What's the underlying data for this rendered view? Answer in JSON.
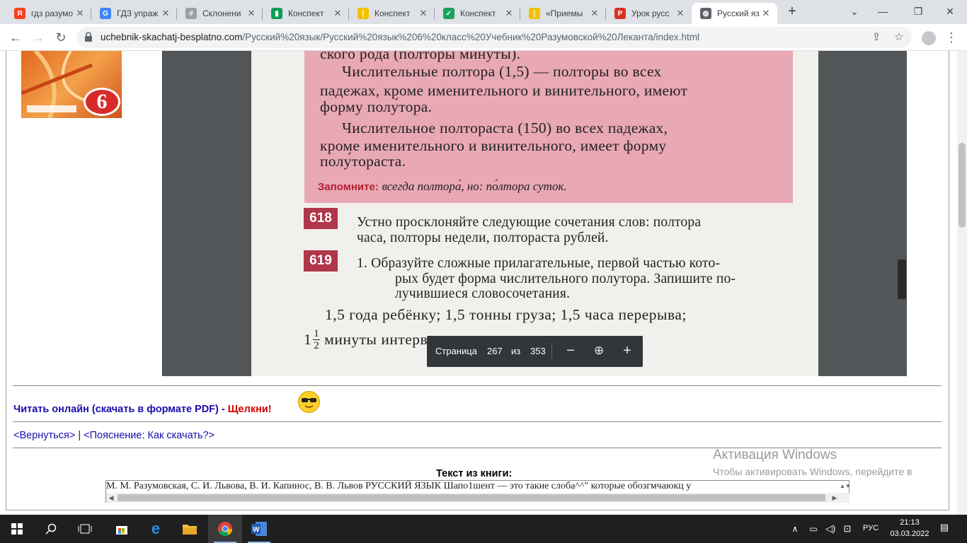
{
  "browser": {
    "tabs": [
      {
        "title": "гдз разумо",
        "favicon": "yandex-icon",
        "color": "#fc3f1d",
        "glyph": "Я"
      },
      {
        "title": "ГДЗ упраж",
        "favicon": "google-icon",
        "color": "#4285f4",
        "glyph": "G"
      },
      {
        "title": "Склонени",
        "favicon": "hash-icon",
        "color": "#9aa0a6",
        "glyph": "#"
      },
      {
        "title": "Конспект",
        "favicon": "sheets-icon",
        "color": "#0f9d58",
        "glyph": "▮"
      },
      {
        "title": "Конспект",
        "favicon": "bookmark-icon",
        "color": "#f6c000",
        "glyph": "❘"
      },
      {
        "title": "Конспект",
        "favicon": "check-icon",
        "color": "#1aa260",
        "glyph": "✓"
      },
      {
        "title": "«Приемы",
        "favicon": "bookmark-icon",
        "color": "#f6c000",
        "glyph": "❘"
      },
      {
        "title": "Урок русс",
        "favicon": "presentation-icon",
        "color": "#d93025",
        "glyph": "P"
      },
      {
        "title": "Русский яз",
        "favicon": "globe-icon",
        "color": "#5f6368",
        "glyph": "◍",
        "active": true
      }
    ],
    "url_domain": "uchebnik-skachatj-besplatno.com",
    "url_path": "/Русский%20язык/Русский%20язык%206%20класс%20Учебник%20Разумовской%20Леканта/index.html",
    "new_tab": "+"
  },
  "cover": {
    "grade": "6"
  },
  "pdf": {
    "pink_lines": [
      "ского рода (полторы минуты).",
      "Числительные полтора (1,5) — полторы во всех",
      "падежах, кроме именительного и винительного, имеют",
      "форму полу́тора.",
      "Числительное полтораста (150) во всех падежах,",
      "кроме именительного и винительного, имеет форму",
      "полу́тораста."
    ],
    "remember_label": "Запомните:",
    "remember_text": "всегда полтора́, но: по́лтора суток.",
    "ex618_num": "618",
    "ex618_lines": [
      "Устно просклоняйте следующие сочетания слов: полтора",
      "часа, полторы недели, полтораста рублей."
    ],
    "ex619_num": "619",
    "ex619_lines": [
      "1. Образуйте сложные прилагательные, первой частью кото-",
      "рых будет форма числительного полутора. Запишите по-",
      "лучившиеся словосочетания."
    ],
    "ex619_task1": "1,5 года ребёнку; 1,5 тонны груза; 1,5 часа перерыва;",
    "ex619_task2_whole": "1",
    "ex619_task2_num": "1",
    "ex619_task2_den": "2",
    "ex619_task2_rest": "минуты интервала",
    "toolbar": {
      "page_label": "Страница",
      "page": "267",
      "of_label": "из",
      "total": "353"
    }
  },
  "page": {
    "read_online": "Читать онлайн (скачать в формате PDF) - ",
    "click_here": "Щелкни!",
    "back_link": "<Вернуться>",
    "separator": "|",
    "help_link": "<Пояснение: Как скачать?>",
    "book_text_title": "Текст из книги:",
    "book_text": "М. М. Разумовская, С. И. Львова, В. И. Капинос, В. В. Львов РУССКИЙ ЯЗЫК Шапо1шент — это такие слоба^^\" которые обозгмчаюкц у"
  },
  "watermark": {
    "title": "Активация Windows",
    "subtitle": "Чтобы активировать Windows, перейдите в"
  },
  "taskbar": {
    "lang": "РУС",
    "time": "21:13",
    "date": "03.03.2022"
  }
}
